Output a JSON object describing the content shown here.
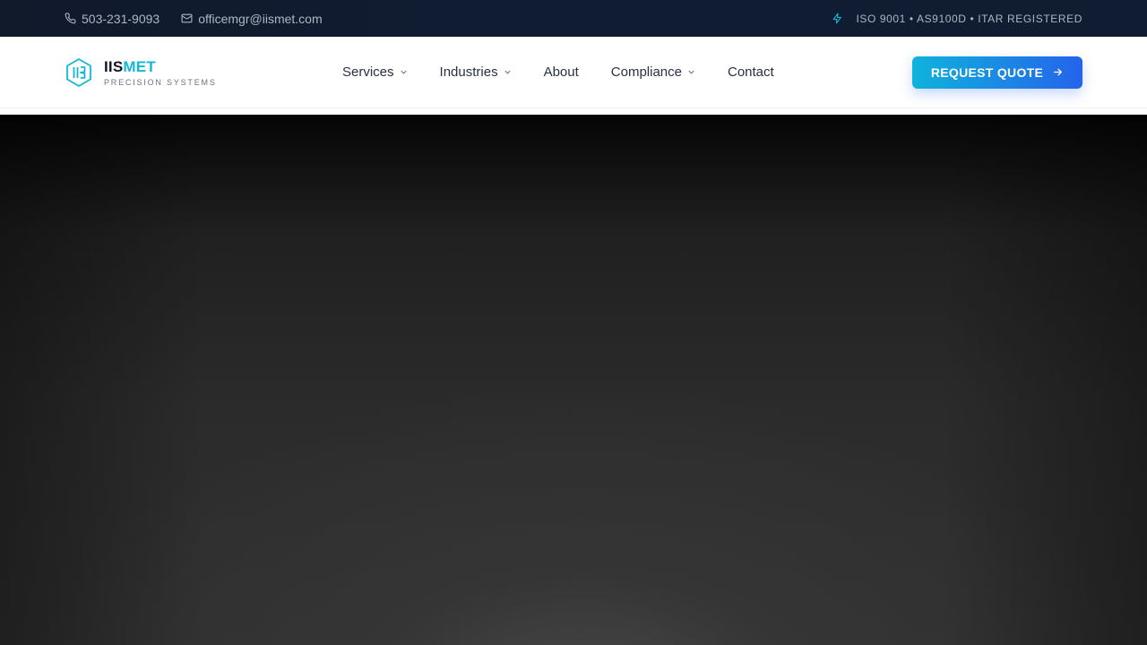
{
  "topbar": {
    "phone": "503-231-9093",
    "email": "officemgr@iismet.com",
    "certifications": "ISO 9001 • AS9100D • ITAR REGISTERED",
    "icons": {
      "phone": "phone-icon",
      "email": "mail-icon",
      "cert": "bolt-icon"
    }
  },
  "brand": {
    "name_part1": "IIS",
    "name_part2": "MET",
    "tagline": "PRECISION SYSTEMS",
    "logo_icon": "hexagon-logo-icon"
  },
  "nav": {
    "items": [
      {
        "label": "Services",
        "has_dropdown": true
      },
      {
        "label": "Industries",
        "has_dropdown": true
      },
      {
        "label": "About",
        "has_dropdown": false
      },
      {
        "label": "Compliance",
        "has_dropdown": true
      },
      {
        "label": "Contact",
        "has_dropdown": false
      }
    ],
    "cta_label": "REQUEST QUOTE"
  },
  "colors": {
    "accent": "#14b8d6",
    "cta_start": "#0fb3dc",
    "cta_end": "#2563eb",
    "topbar_bg": "#111a2b",
    "nav_text": "#273142"
  }
}
